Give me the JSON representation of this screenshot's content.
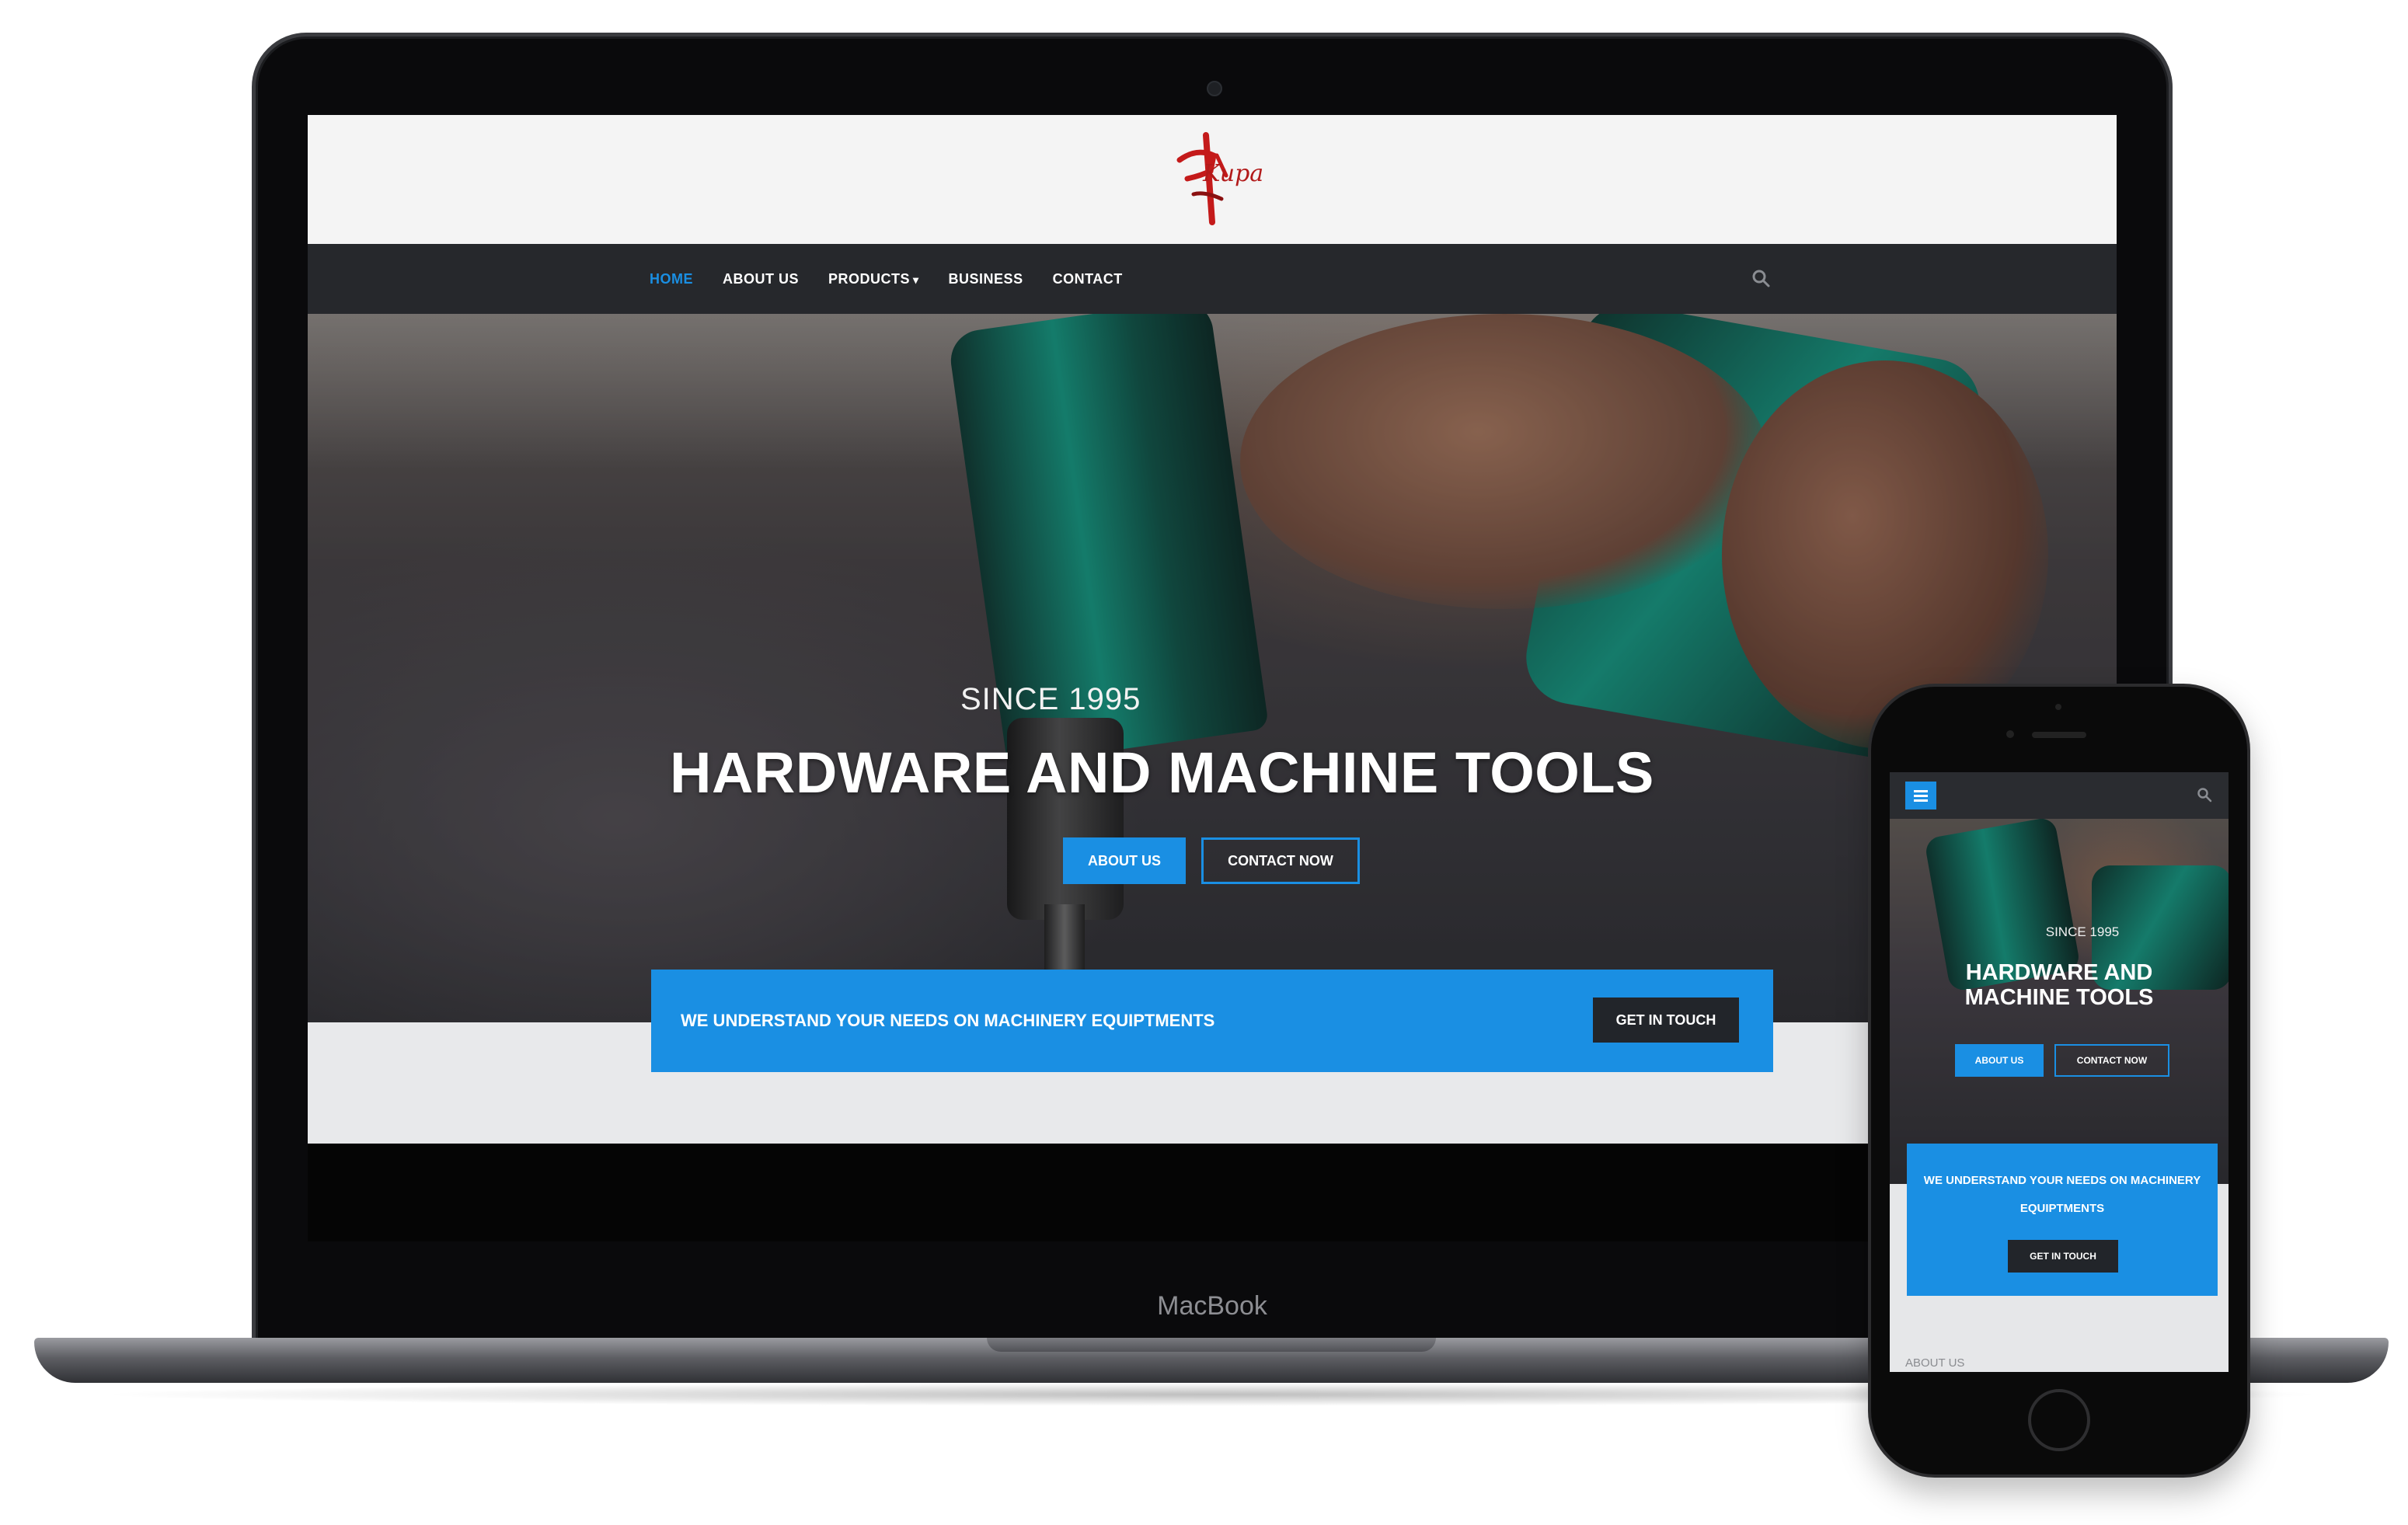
{
  "brand": {
    "logo_text": "Kupa",
    "accent_color": "#1a8fe3",
    "nav_bg": "#26282c",
    "logo_color": "#b21a1a"
  },
  "device": {
    "laptop_label": "MacBook"
  },
  "nav": {
    "items": [
      {
        "label": "HOME",
        "active": true
      },
      {
        "label": "ABOUT US",
        "active": false
      },
      {
        "label": "PRODUCTS",
        "active": false,
        "has_dropdown": true
      },
      {
        "label": "BUSINESS",
        "active": false
      },
      {
        "label": "CONTACT",
        "active": false
      }
    ],
    "search_icon": "search-icon",
    "dropdown_icon": "chevron-down-icon"
  },
  "hero": {
    "kicker": "SINCE 1995",
    "title": "HARDWARE AND MACHINE TOOLS",
    "primary_button": "ABOUT US",
    "secondary_button": "CONTACT NOW"
  },
  "cta": {
    "text": "WE UNDERSTAND YOUR NEEDS ON MACHINERY EQUIPTMENTS",
    "button": "GET IN TOUCH"
  },
  "mobile": {
    "menu_icon": "hamburger-menu-icon",
    "search_icon": "search-icon",
    "kicker": "SINCE 1995",
    "title": "HARDWARE AND MACHINE TOOLS",
    "primary_button": "ABOUT US",
    "secondary_button": "CONTACT NOW",
    "cta_text": "WE UNDERSTAND YOUR NEEDS ON MACHINERY EQUIPTMENTS",
    "cta_button": "GET IN TOUCH",
    "section_heading": "ABOUT US"
  }
}
